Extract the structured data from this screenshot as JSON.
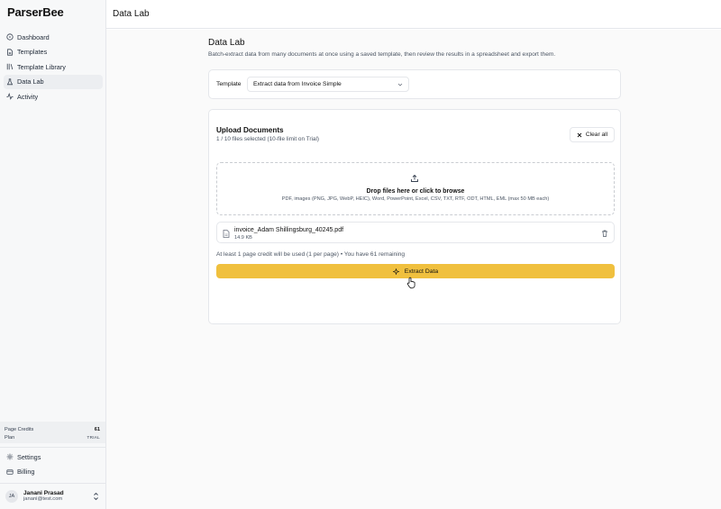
{
  "app": {
    "logo": "ParserBee"
  },
  "sidebar": {
    "items": [
      {
        "label": "Dashboard",
        "icon": "dashboard-icon"
      },
      {
        "label": "Templates",
        "icon": "templates-icon"
      },
      {
        "label": "Template Library",
        "icon": "library-icon"
      },
      {
        "label": "Data Lab",
        "icon": "flask-icon",
        "active": true
      },
      {
        "label": "Activity",
        "icon": "activity-icon"
      }
    ],
    "credits": {
      "label": "Page Credits",
      "value": "61"
    },
    "plan": {
      "label": "Plan",
      "value": "TRIAL"
    },
    "bottom_items": [
      {
        "label": "Settings",
        "icon": "gear-icon"
      },
      {
        "label": "Billing",
        "icon": "credit-card-icon"
      }
    ],
    "user": {
      "initials": "JA",
      "name": "Janani Prasad",
      "email": "janani@test.com"
    }
  },
  "topbar": {
    "title": "Data Lab"
  },
  "page": {
    "title": "Data Lab",
    "subtitle": "Batch-extract data from many documents at once using a saved template, then review the results in a spreadsheet and export them."
  },
  "template": {
    "label": "Template",
    "selected": "Extract data from Invoice Simple"
  },
  "upload": {
    "title": "Upload Documents",
    "subtitle": "1 / 10 files selected (10-file limit on Trial)",
    "clear_label": "Clear all",
    "dropzone_main": "Drop files here or click to browse",
    "dropzone_hint": "PDF, images (PNG, JPG, WebP, HEIC), Word, PowerPoint, Excel, CSV, TXT, RTF, ODT, HTML, EML (max 50 MB each)",
    "files": [
      {
        "name": "invoice_Adam Shillingsburg_40245.pdf",
        "size": "14.9 KB"
      }
    ],
    "credit_note": "At least 1 page credit will be used (1 per page) • You have 61 remaining",
    "extract_label": "Extract Data"
  },
  "colors": {
    "accent": "#f0c03e",
    "sidebar_bg": "#f7f8f9",
    "active_bg": "#eceef1"
  }
}
